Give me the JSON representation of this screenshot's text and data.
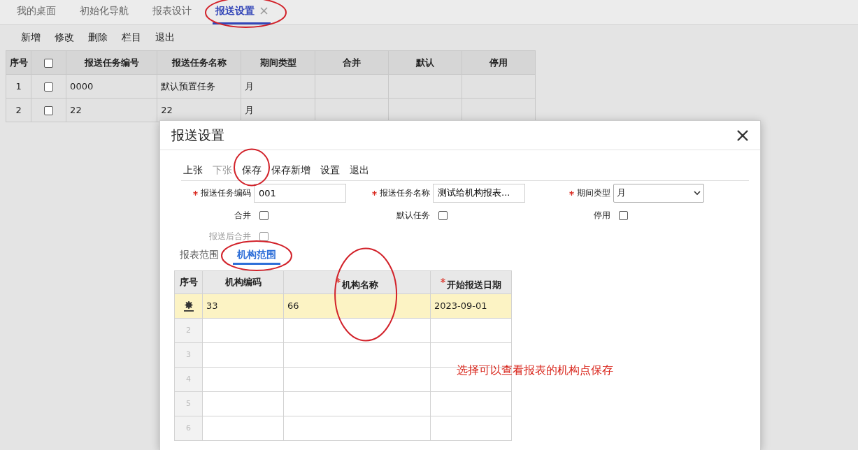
{
  "tabs": [
    {
      "label": "我的桌面",
      "selected": false,
      "closable": false
    },
    {
      "label": "初始化导航",
      "selected": false,
      "closable": false
    },
    {
      "label": "报表设计",
      "selected": false,
      "closable": false
    },
    {
      "label": "报送设置",
      "selected": true,
      "closable": true
    }
  ],
  "toolbar": [
    "新增",
    "修改",
    "删除",
    "栏目",
    "退出"
  ],
  "task_table": {
    "columns": [
      {
        "kind": "text",
        "label": "序号"
      },
      {
        "kind": "checkbox",
        "checked": false
      },
      {
        "kind": "text",
        "label": "报送任务编号"
      },
      {
        "kind": "text",
        "label": "报送任务名称"
      },
      {
        "kind": "text",
        "label": "期间类型"
      },
      {
        "kind": "text",
        "label": "合并"
      },
      {
        "kind": "text",
        "label": "默认"
      },
      {
        "kind": "text",
        "label": "停用"
      }
    ],
    "rows": [
      {
        "index": "1",
        "checked": false,
        "code": "0000",
        "name": "默认预置任务",
        "period": "月"
      },
      {
        "index": "2",
        "checked": false,
        "code": "22",
        "name": "22",
        "period": "月"
      }
    ]
  },
  "dialog": {
    "title": "报送设置",
    "toolbar": [
      {
        "label": "上张",
        "disabled": false
      },
      {
        "label": "下张",
        "disabled": true
      },
      {
        "label": "保存",
        "disabled": false
      },
      {
        "label": "保存新增",
        "disabled": false
      },
      {
        "label": "设置",
        "disabled": false
      },
      {
        "label": "退出",
        "disabled": false
      }
    ],
    "fields": [
      {
        "label": "报送任务编码",
        "required": true,
        "kind": "text",
        "value": "001"
      },
      {
        "label": "报送任务名称",
        "required": true,
        "kind": "text",
        "value": "测试给机构报表..."
      },
      {
        "label": "期间类型",
        "required": true,
        "kind": "select",
        "value": "月"
      }
    ],
    "options": [
      {
        "label": "合并",
        "checked": false,
        "disabled": false
      },
      {
        "label": "默认任务",
        "checked": false,
        "disabled": false
      },
      {
        "label": "停用",
        "checked": false,
        "disabled": false
      },
      {
        "label": "报送后合并",
        "checked": false,
        "disabled": true
      }
    ],
    "tabs": [
      {
        "label": "报表范围",
        "selected": false
      },
      {
        "label": "机构范围",
        "selected": true
      }
    ],
    "grid": {
      "columns": [
        {
          "label": "序号",
          "required": false
        },
        {
          "label": "机构编码",
          "required": false
        },
        {
          "label": "机构名称",
          "required": true
        },
        {
          "label": "开始报送日期",
          "required": true
        }
      ],
      "rows": [
        {
          "selected": true,
          "cells": [
            "",
            "33",
            "66",
            "2023-09-01"
          ]
        },
        {
          "selected": false,
          "cells": [
            "2",
            "",
            "",
            ""
          ]
        },
        {
          "selected": false,
          "cells": [
            "3",
            "",
            "",
            ""
          ]
        },
        {
          "selected": false,
          "cells": [
            "4",
            "",
            "",
            ""
          ]
        },
        {
          "selected": false,
          "cells": [
            "5",
            "",
            "",
            ""
          ]
        },
        {
          "selected": false,
          "cells": [
            "6",
            "",
            "",
            ""
          ]
        }
      ]
    }
  },
  "annotation": {
    "note": "选择可以查看报表的机构点保存"
  }
}
